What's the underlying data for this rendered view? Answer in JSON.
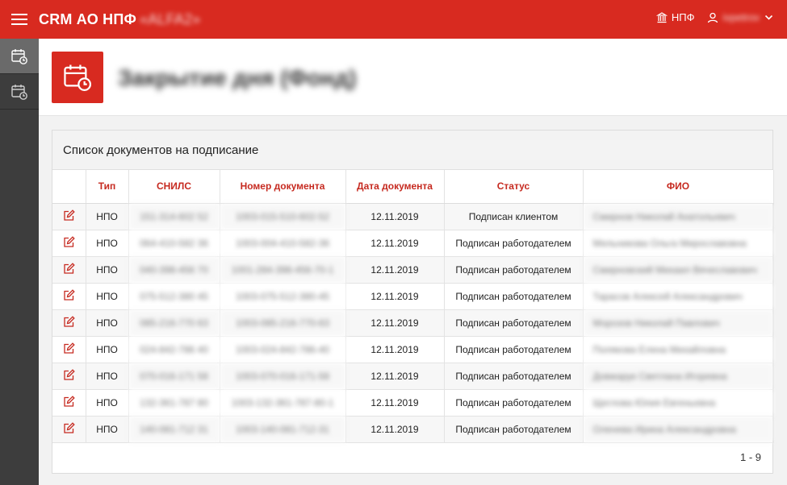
{
  "app": {
    "title": "CRM АО НПФ",
    "title_blurred": "«ALFA2»",
    "fund_label": "НПФ",
    "user_name": "ivpetrov",
    "accent_color": "#d82a20"
  },
  "icons": {
    "menu": "hamburger-icon",
    "fund": "building-icon",
    "user": "user-icon",
    "dropdown": "chevron-down-icon",
    "sidebar_1": "calendar-clock-icon",
    "sidebar_2": "calendar-clock-icon",
    "header": "calendar-clock-icon",
    "row_action": "edit-icon"
  },
  "page": {
    "title": "Закрытие дня (Фонд)"
  },
  "panel": {
    "title": "Список документов на подписание"
  },
  "table": {
    "columns": [
      "",
      "Тип",
      "СНИЛС",
      "Номер документа",
      "Дата документа",
      "Статус",
      "ФИО"
    ],
    "rows": [
      {
        "type": "НПО",
        "snils": "151-314-602 52",
        "doc": "1003-015-510-602-52",
        "date": "12.11.2019",
        "status": "Подписан клиентом",
        "fio": "Смирнов Николай Анатольевич"
      },
      {
        "type": "НПО",
        "snils": "064-410-582 36",
        "doc": "1003-004-410-582-36",
        "date": "12.11.2019",
        "status": "Подписан работодателем",
        "fio": "Мельникова Ольга Мирославовна"
      },
      {
        "type": "НПО",
        "snils": "040-398-456 70",
        "doc": "1001-284-398-456-70-1",
        "date": "12.11.2019",
        "status": "Подписан работодателем",
        "fio": "Смирновский Михаил Вячеславович"
      },
      {
        "type": "НПО",
        "snils": "075-512-380 45",
        "doc": "1003-075-512-380-45",
        "date": "12.11.2019",
        "status": "Подписан работодателем",
        "fio": "Тарасов Алексей Александрович"
      },
      {
        "type": "НПО",
        "snils": "085-216-770 63",
        "doc": "1003-085-216-770-63",
        "date": "12.11.2019",
        "status": "Подписан работодателем",
        "fio": "Морозов Николай Павлович"
      },
      {
        "type": "НПО",
        "snils": "024-842-786 40",
        "doc": "1003-024-842-786-40",
        "date": "12.11.2019",
        "status": "Подписан работодателем",
        "fio": "Полякова Елена Михайловна"
      },
      {
        "type": "НПО",
        "snils": "070-016-171 58",
        "doc": "1003-070-016-171-58",
        "date": "12.11.2019",
        "status": "Подписан работодателем",
        "fio": "Довжарук Светлана Игоревна"
      },
      {
        "type": "НПО",
        "snils": "132-361-787 80",
        "doc": "1003-132-361-787-80-1",
        "date": "12.11.2019",
        "status": "Подписан работодателем",
        "fio": "Щеглова Юлия Евгеньевна"
      },
      {
        "type": "НПО",
        "snils": "140-081-712 31",
        "doc": "1003-140-081-712-31",
        "date": "12.11.2019",
        "status": "Подписан работодателем",
        "fio": "Оленева Ирина Александровна"
      }
    ]
  },
  "pagination": {
    "label": "1 - 9"
  }
}
